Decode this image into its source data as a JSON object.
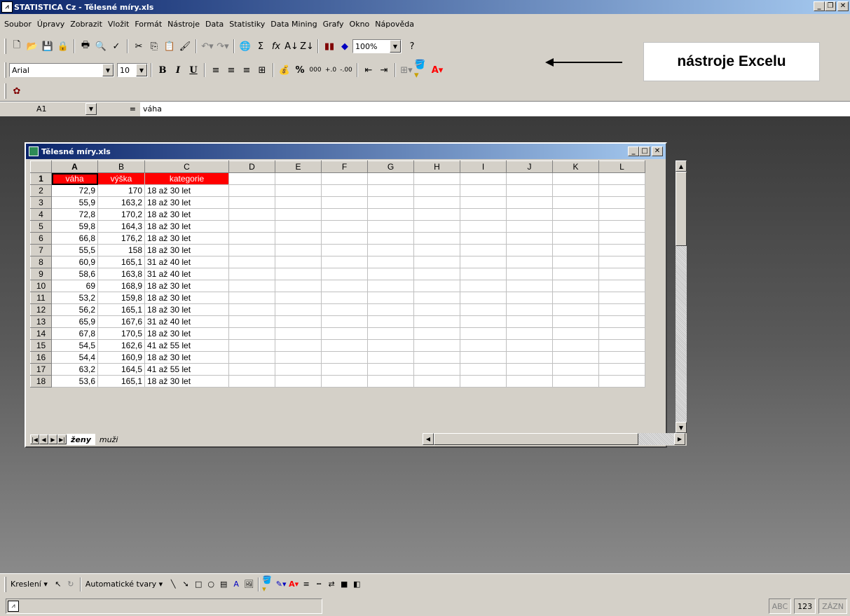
{
  "app": {
    "title": "STATISTICA Cz - Tělesné míry.xls"
  },
  "menu": [
    "Soubor",
    "Úpravy",
    "Zobrazit",
    "Vložit",
    "Formát",
    "Nástroje",
    "Data",
    "Statistiky",
    "Data Mining",
    "Grafy",
    "Okno",
    "Nápověda"
  ],
  "toolbar": {
    "zoom": "100%",
    "font": "Arial",
    "font_size": "10"
  },
  "callout": {
    "text": "nástroje Excelu"
  },
  "formula_bar": {
    "cell_ref": "A1",
    "eq": "=",
    "value": "váha"
  },
  "workbook": {
    "title": "Tělesné míry.xls",
    "columns": [
      "A",
      "B",
      "C",
      "D",
      "E",
      "F",
      "G",
      "H",
      "I",
      "J",
      "K",
      "L"
    ],
    "header_row": {
      "rownum": "1",
      "a": "váha",
      "b": "výška",
      "c": "kategorie"
    },
    "rows": [
      {
        "rownum": "2",
        "a": "72,9",
        "b": "170",
        "c": "18 až 30 let"
      },
      {
        "rownum": "3",
        "a": "55,9",
        "b": "163,2",
        "c": "18 až 30 let"
      },
      {
        "rownum": "4",
        "a": "72,8",
        "b": "170,2",
        "c": "18 až 30 let"
      },
      {
        "rownum": "5",
        "a": "59,8",
        "b": "164,3",
        "c": "18 až 30 let"
      },
      {
        "rownum": "6",
        "a": "66,8",
        "b": "176,2",
        "c": "18 až 30 let"
      },
      {
        "rownum": "7",
        "a": "55,5",
        "b": "158",
        "c": "18 až 30 let"
      },
      {
        "rownum": "8",
        "a": "60,9",
        "b": "165,1",
        "c": "31 až 40 let"
      },
      {
        "rownum": "9",
        "a": "58,6",
        "b": "163,8",
        "c": "31 až 40 let"
      },
      {
        "rownum": "10",
        "a": "69",
        "b": "168,9",
        "c": "18 až 30 let"
      },
      {
        "rownum": "11",
        "a": "53,2",
        "b": "159,8",
        "c": "18 až 30 let"
      },
      {
        "rownum": "12",
        "a": "56,2",
        "b": "165,1",
        "c": "18 až 30 let"
      },
      {
        "rownum": "13",
        "a": "65,9",
        "b": "167,6",
        "c": "31 až 40 let"
      },
      {
        "rownum": "14",
        "a": "67,8",
        "b": "170,5",
        "c": "18 až 30 let"
      },
      {
        "rownum": "15",
        "a": "54,5",
        "b": "162,6",
        "c": "41 až 55 let"
      },
      {
        "rownum": "16",
        "a": "54,4",
        "b": "160,9",
        "c": "18 až 30 let"
      },
      {
        "rownum": "17",
        "a": "63,2",
        "b": "164,5",
        "c": "41 až 55 let"
      },
      {
        "rownum": "18",
        "a": "53,6",
        "b": "165,1",
        "c": "18 až 30 let"
      }
    ],
    "sheets": [
      "ženy",
      "muži"
    ]
  },
  "drawing_toolbar": {
    "draw_label": "Kreslení ▾",
    "autoshapes_label": "Automatické tvary ▾"
  },
  "status": {
    "indicators": [
      "ABC",
      "123",
      "ZÁZN"
    ]
  },
  "colors": {
    "title_start": "#0a246a",
    "title_end": "#a6caf0",
    "header_fill": "#ff0000"
  }
}
